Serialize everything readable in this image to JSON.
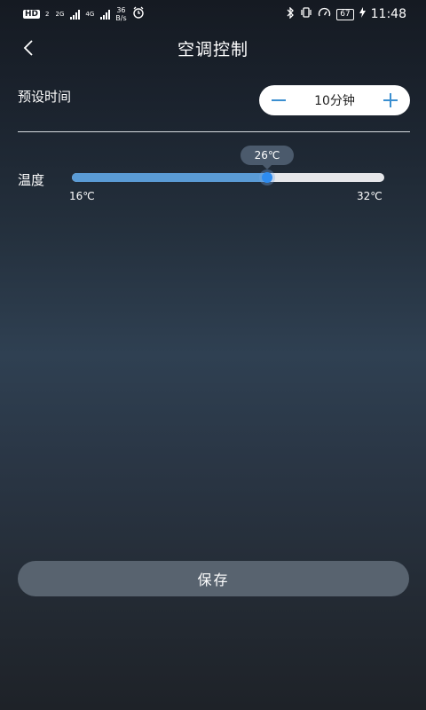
{
  "status_bar": {
    "hd": "HD",
    "sim1": "2",
    "net1": "2G",
    "net2": "4G",
    "speed_value": "36",
    "speed_unit": "B/s",
    "battery": "67",
    "time": "11:48"
  },
  "nav": {
    "title": "空调控制"
  },
  "preset": {
    "label": "预设时间",
    "value": "10分钟",
    "decrement": "−",
    "increment": "+"
  },
  "temperature": {
    "label": "温度",
    "min": 16,
    "max": 32,
    "current": 26,
    "min_label": "16℃",
    "max_label": "32℃",
    "current_label": "26℃"
  },
  "save": {
    "label": "保存"
  },
  "colors": {
    "accent": "#5a9bd5",
    "thumb": "#2e8cf0",
    "button": "#58636f"
  }
}
